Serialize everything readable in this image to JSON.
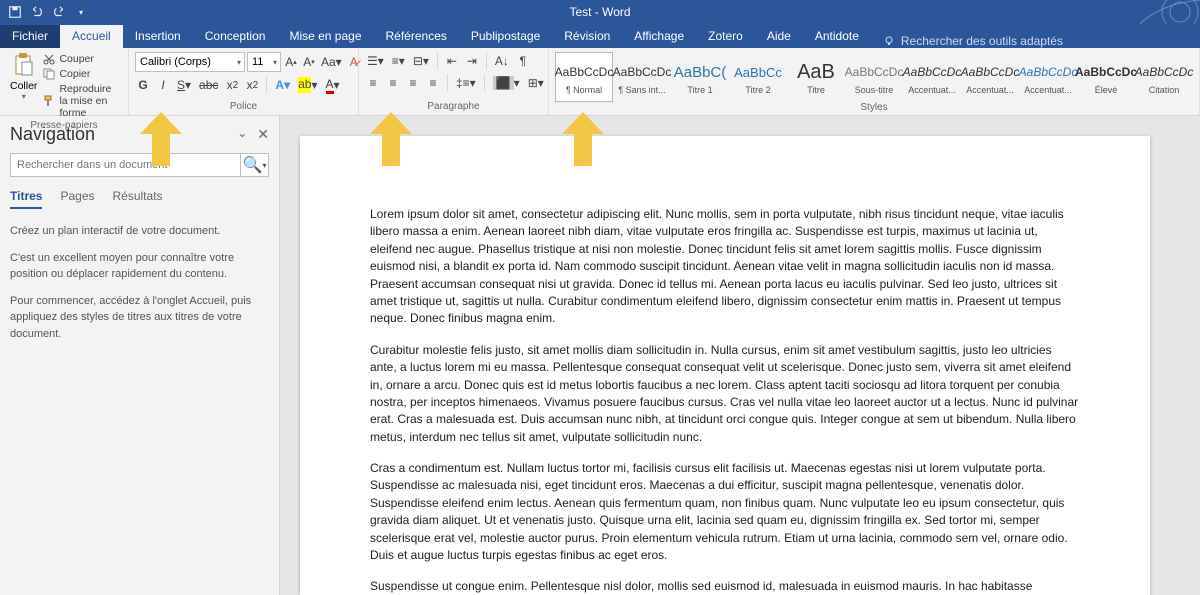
{
  "title": "Test  -  Word",
  "tabs": [
    "Fichier",
    "Accueil",
    "Insertion",
    "Conception",
    "Mise en page",
    "Références",
    "Publipostage",
    "Révision",
    "Affichage",
    "Zotero",
    "Aide",
    "Antidote"
  ],
  "active_tab": "Accueil",
  "tell_me": "Rechercher des outils adaptés",
  "clipboard": {
    "paste": "Coller",
    "cut": "Couper",
    "copy": "Copier",
    "painter": "Reproduire la mise en forme",
    "label": "Presse-papiers"
  },
  "font": {
    "name": "Calibri (Corps)",
    "size": "11",
    "label": "Police"
  },
  "paragraph": {
    "label": "Paragraphe"
  },
  "styles": {
    "label": "Styles",
    "items": [
      {
        "preview": "AaBbCcDc",
        "name": "¶ Normal",
        "sel": true,
        "color": "#333"
      },
      {
        "preview": "AaBbCcDc",
        "name": "¶ Sans int...",
        "color": "#333"
      },
      {
        "preview": "AaBbC(",
        "name": "Titre 1",
        "color": "#2e74b5",
        "size": "15px"
      },
      {
        "preview": "AaBbCc",
        "name": "Titre 2",
        "color": "#2e74b5",
        "size": "13px"
      },
      {
        "preview": "AaB",
        "name": "Titre",
        "color": "#333",
        "size": "20px"
      },
      {
        "preview": "AaBbCcDc",
        "name": "Sous-titre",
        "color": "#777"
      },
      {
        "preview": "AaBbCcDc",
        "name": "Accentuat...",
        "style": "italic",
        "color": "#333"
      },
      {
        "preview": "AaBbCcDc",
        "name": "Accentuat...",
        "style": "italic",
        "color": "#333"
      },
      {
        "preview": "AaBbCcDc",
        "name": "Accentuat...",
        "style": "italic",
        "color": "#2e74b5"
      },
      {
        "preview": "AaBbCcDc",
        "name": "Élevé",
        "color": "#333",
        "weight": "bold"
      },
      {
        "preview": "AaBbCcDc",
        "name": "Citation",
        "style": "italic",
        "color": "#333"
      }
    ]
  },
  "nav": {
    "title": "Navigation",
    "placeholder": "Rechercher dans un document",
    "tabs": [
      "Titres",
      "Pages",
      "Résultats"
    ],
    "help": [
      "Créez un plan interactif de votre document.",
      "C'est un excellent moyen pour connaître votre position ou déplacer rapidement du contenu.",
      "Pour commencer, accédez à l'onglet Accueil, puis appliquez des styles de titres aux titres de votre document."
    ]
  },
  "doc": {
    "p1": "Lorem ipsum dolor sit amet, consectetur adipiscing elit. Nunc mollis, sem in porta vulputate, nibh risus tincidunt neque, vitae iaculis libero massa a enim. Aenean laoreet nibh diam, vitae vulputate eros fringilla ac. Suspendisse est turpis, maximus ut lacinia ut, eleifend nec augue. Phasellus tristique at nisi non molestie. Donec tincidunt felis sit amet lorem sagittis mollis. Fusce dignissim euismod nisi, a blandit ex porta id. Nam commodo suscipit tincidunt. Aenean vitae velit in magna sollicitudin iaculis non id massa. Praesent accumsan consequat nisi ut gravida. Donec id tellus mi. Aenean porta lacus eu iaculis pulvinar. Sed leo justo, ultrices sit amet tristique ut, sagittis ut nulla. Curabitur condimentum eleifend libero, dignissim consectetur enim mattis in. Praesent ut tempus neque. Donec finibus magna enim.",
    "p2": "Curabitur molestie felis justo, sit amet mollis diam sollicitudin in. Nulla cursus, enim sit amet vestibulum sagittis, justo leo ultricies ante, a luctus lorem mi eu massa. Pellentesque consequat consequat velit ut scelerisque. Donec justo sem, viverra sit amet eleifend in, ornare a arcu. Donec quis est id metus lobortis faucibus a nec lorem. Class aptent taciti sociosqu ad litora torquent per conubia nostra, per inceptos himenaeos. Vivamus posuere faucibus cursus. Cras vel nulla vitae leo laoreet auctor ut a lectus. Nunc id pulvinar erat. Cras a malesuada est. Duis accumsan nunc nibh, at tincidunt orci congue quis. Integer congue at sem ut bibendum. Nulla libero metus, interdum nec tellus sit amet, vulputate sollicitudin nunc.",
    "p3": "Cras a condimentum est. Nullam luctus tortor mi, facilisis cursus elit facilisis ut. Maecenas egestas nisi ut lorem vulputate porta. Suspendisse ac malesuada nisi, eget tincidunt eros. Maecenas a dui efficitur, suscipit magna pellentesque, venenatis dolor. Suspendisse eleifend enim lectus. Aenean quis fermentum quam, non finibus quam. Nunc vulputate leo eu ipsum consectetur, quis gravida diam aliquet. Ut et venenatis justo. Quisque urna elit, lacinia sed quam eu, dignissim fringilla ex. Sed tortor mi, semper scelerisque erat vel, molestie auctor purus. Proin elementum vehicula rutrum. Etiam ut urna lacinia, commodo sem vel, ornare odio. Duis et augue luctus turpis egestas finibus ac eget eros.",
    "p4": "Suspendisse ut congue enim. Pellentesque nisl dolor, mollis sed euismod id, malesuada in euismod mauris. In hac habitasse"
  }
}
